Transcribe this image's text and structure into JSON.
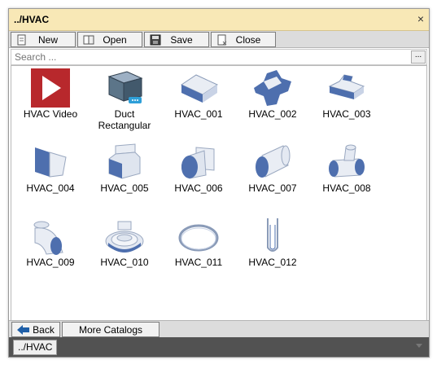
{
  "window": {
    "title": "../HVAC",
    "close_glyph": "×"
  },
  "toolbar": {
    "buttons": [
      {
        "label": "New",
        "icon": "new-document-icon"
      },
      {
        "label": "Open",
        "icon": "open-book-icon"
      },
      {
        "label": "Save",
        "icon": "save-disk-icon"
      },
      {
        "label": "Close",
        "icon": "close-document-icon"
      }
    ]
  },
  "search": {
    "placeholder": "Search ...",
    "value": "",
    "browse_label": "..."
  },
  "items": [
    {
      "line1": "HVAC Video",
      "line2": "",
      "icon": "video-play-icon"
    },
    {
      "line1": "Duct",
      "line2": "Rectangular",
      "icon": "duct-rectangular-icon"
    },
    {
      "line1": "HVAC_001",
      "line2": "",
      "icon": "duct-straight-icon"
    },
    {
      "line1": "HVAC_002",
      "line2": "",
      "icon": "duct-cross-icon"
    },
    {
      "line1": "HVAC_003",
      "line2": "",
      "icon": "duct-tee-icon"
    },
    {
      "line1": "HVAC_004",
      "line2": "",
      "icon": "duct-transition-icon"
    },
    {
      "line1": "HVAC_005",
      "line2": "",
      "icon": "duct-offset-icon"
    },
    {
      "line1": "HVAC_006",
      "line2": "",
      "icon": "duct-round-transition-icon"
    },
    {
      "line1": "HVAC_007",
      "line2": "",
      "icon": "round-duct-icon"
    },
    {
      "line1": "HVAC_008",
      "line2": "",
      "icon": "round-tee-icon"
    },
    {
      "line1": "HVAC_009",
      "line2": "",
      "icon": "round-elbow-icon"
    },
    {
      "line1": "HVAC_010",
      "line2": "",
      "icon": "diffuser-icon"
    },
    {
      "line1": "HVAC_011",
      "line2": "",
      "icon": "duct-clamp-ring-icon"
    },
    {
      "line1": "HVAC_012",
      "line2": "",
      "icon": "hanger-strap-icon"
    }
  ],
  "bottom": {
    "back_label": "Back",
    "more_label": "More Catalogs"
  },
  "path": {
    "crumb": "../HVAC"
  },
  "colors": {
    "title_bg": "#f8e8b6",
    "duct_blue": "#4e6fae",
    "video_red": "#b8282c"
  }
}
